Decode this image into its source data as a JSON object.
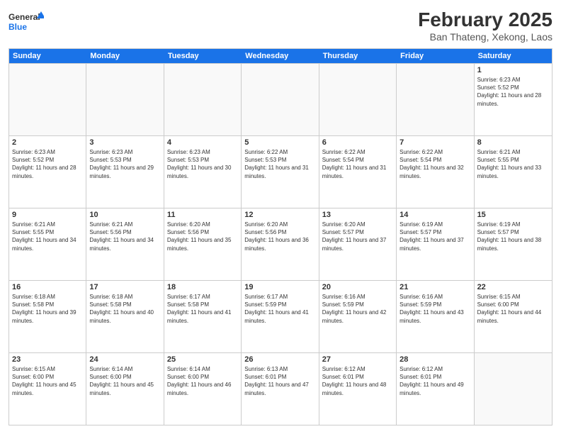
{
  "header": {
    "logo_general": "General",
    "logo_blue": "Blue",
    "main_title": "February 2025",
    "subtitle": "Ban Thateng, Xekong, Laos"
  },
  "days_of_week": [
    "Sunday",
    "Monday",
    "Tuesday",
    "Wednesday",
    "Thursday",
    "Friday",
    "Saturday"
  ],
  "weeks": [
    [
      {
        "day": "",
        "info": ""
      },
      {
        "day": "",
        "info": ""
      },
      {
        "day": "",
        "info": ""
      },
      {
        "day": "",
        "info": ""
      },
      {
        "day": "",
        "info": ""
      },
      {
        "day": "",
        "info": ""
      },
      {
        "day": "1",
        "info": "Sunrise: 6:23 AM\nSunset: 5:52 PM\nDaylight: 11 hours and 28 minutes."
      }
    ],
    [
      {
        "day": "2",
        "info": "Sunrise: 6:23 AM\nSunset: 5:52 PM\nDaylight: 11 hours and 28 minutes."
      },
      {
        "day": "3",
        "info": "Sunrise: 6:23 AM\nSunset: 5:53 PM\nDaylight: 11 hours and 29 minutes."
      },
      {
        "day": "4",
        "info": "Sunrise: 6:23 AM\nSunset: 5:53 PM\nDaylight: 11 hours and 30 minutes."
      },
      {
        "day": "5",
        "info": "Sunrise: 6:22 AM\nSunset: 5:53 PM\nDaylight: 11 hours and 31 minutes."
      },
      {
        "day": "6",
        "info": "Sunrise: 6:22 AM\nSunset: 5:54 PM\nDaylight: 11 hours and 31 minutes."
      },
      {
        "day": "7",
        "info": "Sunrise: 6:22 AM\nSunset: 5:54 PM\nDaylight: 11 hours and 32 minutes."
      },
      {
        "day": "8",
        "info": "Sunrise: 6:21 AM\nSunset: 5:55 PM\nDaylight: 11 hours and 33 minutes."
      }
    ],
    [
      {
        "day": "9",
        "info": "Sunrise: 6:21 AM\nSunset: 5:55 PM\nDaylight: 11 hours and 34 minutes."
      },
      {
        "day": "10",
        "info": "Sunrise: 6:21 AM\nSunset: 5:56 PM\nDaylight: 11 hours and 34 minutes."
      },
      {
        "day": "11",
        "info": "Sunrise: 6:20 AM\nSunset: 5:56 PM\nDaylight: 11 hours and 35 minutes."
      },
      {
        "day": "12",
        "info": "Sunrise: 6:20 AM\nSunset: 5:56 PM\nDaylight: 11 hours and 36 minutes."
      },
      {
        "day": "13",
        "info": "Sunrise: 6:20 AM\nSunset: 5:57 PM\nDaylight: 11 hours and 37 minutes."
      },
      {
        "day": "14",
        "info": "Sunrise: 6:19 AM\nSunset: 5:57 PM\nDaylight: 11 hours and 37 minutes."
      },
      {
        "day": "15",
        "info": "Sunrise: 6:19 AM\nSunset: 5:57 PM\nDaylight: 11 hours and 38 minutes."
      }
    ],
    [
      {
        "day": "16",
        "info": "Sunrise: 6:18 AM\nSunset: 5:58 PM\nDaylight: 11 hours and 39 minutes."
      },
      {
        "day": "17",
        "info": "Sunrise: 6:18 AM\nSunset: 5:58 PM\nDaylight: 11 hours and 40 minutes."
      },
      {
        "day": "18",
        "info": "Sunrise: 6:17 AM\nSunset: 5:58 PM\nDaylight: 11 hours and 41 minutes."
      },
      {
        "day": "19",
        "info": "Sunrise: 6:17 AM\nSunset: 5:59 PM\nDaylight: 11 hours and 41 minutes."
      },
      {
        "day": "20",
        "info": "Sunrise: 6:16 AM\nSunset: 5:59 PM\nDaylight: 11 hours and 42 minutes."
      },
      {
        "day": "21",
        "info": "Sunrise: 6:16 AM\nSunset: 5:59 PM\nDaylight: 11 hours and 43 minutes."
      },
      {
        "day": "22",
        "info": "Sunrise: 6:15 AM\nSunset: 6:00 PM\nDaylight: 11 hours and 44 minutes."
      }
    ],
    [
      {
        "day": "23",
        "info": "Sunrise: 6:15 AM\nSunset: 6:00 PM\nDaylight: 11 hours and 45 minutes."
      },
      {
        "day": "24",
        "info": "Sunrise: 6:14 AM\nSunset: 6:00 PM\nDaylight: 11 hours and 45 minutes."
      },
      {
        "day": "25",
        "info": "Sunrise: 6:14 AM\nSunset: 6:00 PM\nDaylight: 11 hours and 46 minutes."
      },
      {
        "day": "26",
        "info": "Sunrise: 6:13 AM\nSunset: 6:01 PM\nDaylight: 11 hours and 47 minutes."
      },
      {
        "day": "27",
        "info": "Sunrise: 6:12 AM\nSunset: 6:01 PM\nDaylight: 11 hours and 48 minutes."
      },
      {
        "day": "28",
        "info": "Sunrise: 6:12 AM\nSunset: 6:01 PM\nDaylight: 11 hours and 49 minutes."
      },
      {
        "day": "",
        "info": ""
      }
    ]
  ]
}
